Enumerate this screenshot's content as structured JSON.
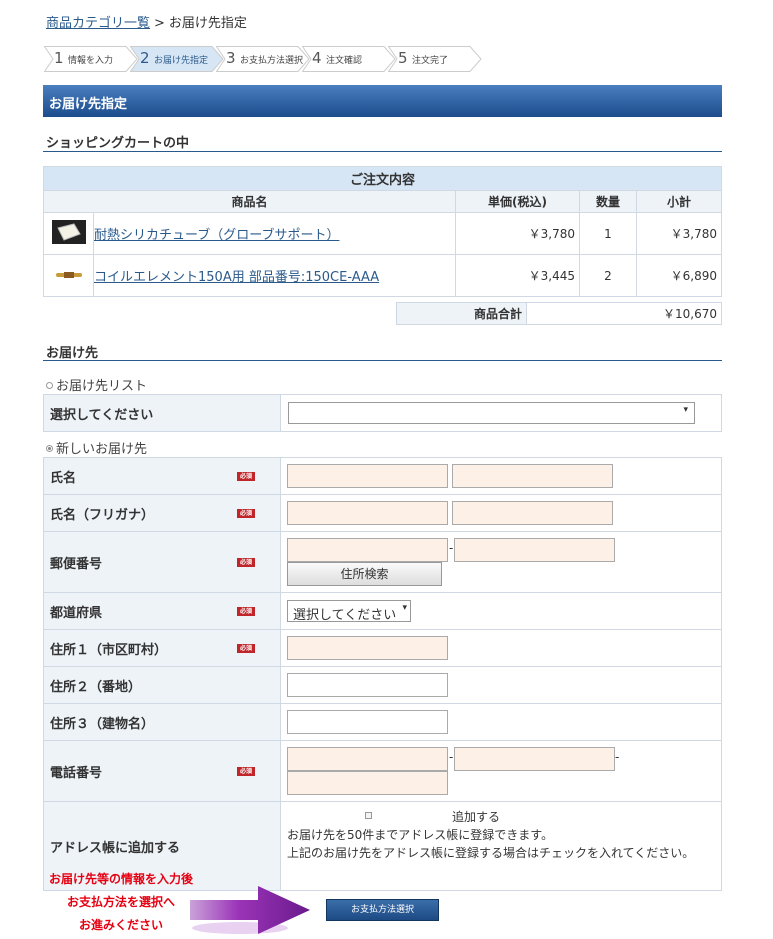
{
  "breadcrumb": {
    "link": "商品カテゴリ一覧",
    "sep": ">",
    "current": "お届け先指定"
  },
  "steps": [
    {
      "num": "1",
      "label": "情報を入力"
    },
    {
      "num": "2",
      "label": "お届け先指定"
    },
    {
      "num": "3",
      "label": "お支払方法選択"
    },
    {
      "num": "4",
      "label": "注文確認"
    },
    {
      "num": "5",
      "label": "注文完了"
    }
  ],
  "title": "お届け先指定",
  "cart": {
    "heading": "ショッピングカートの中",
    "caption": "ご注文内容",
    "headers": {
      "name": "商品名",
      "price": "単価(税込)",
      "qty": "数量",
      "sub": "小計"
    },
    "rows": [
      {
        "name": "耐熱シリカチューブ（グローブサポート）",
        "price": "￥3,780",
        "qty": "1",
        "sub": "￥3,780"
      },
      {
        "name": "コイルエレメント150A用 部品番号:150CE-AAA",
        "price": "￥3,445",
        "qty": "2",
        "sub": "￥6,890"
      }
    ],
    "total_label": "商品合計",
    "total_value": "￥10,670"
  },
  "shipping": {
    "heading": "お届け先",
    "list_radio": "お届け先リスト",
    "list_label": "選択してください",
    "new_radio": "新しいお届け先",
    "required_badge": "必須",
    "fields": {
      "name": "氏名",
      "kana": "氏名（フリガナ）",
      "zip": "郵便番号",
      "zip_sep": "-",
      "zip_button": "住所検索",
      "pref": "都道府県",
      "pref_select": "選択してください",
      "addr1": "住所１（市区町村）",
      "addr2": "住所２（番地）",
      "addr3": "住所３（建物名）",
      "tel": "電話番号",
      "tel_sep": "-",
      "book": "アドレス帳に追加する",
      "book_check": "追加する",
      "book_note1": "お届け先を50件までアドレス帳に登録できます。",
      "book_note2": "上記のお届け先をアドレス帳に登録する場合はチェックを入れてください。"
    }
  },
  "hint": {
    "line1": "お届け先等の情報を入力後",
    "line2": "お支払方法を選択へ",
    "line3": "お進みください"
  },
  "submit_label": "お支払方法選択",
  "colors": {
    "accent": "#1c4c8c",
    "hint_red": "#e60012",
    "input_pink": "#fdf1e7"
  }
}
